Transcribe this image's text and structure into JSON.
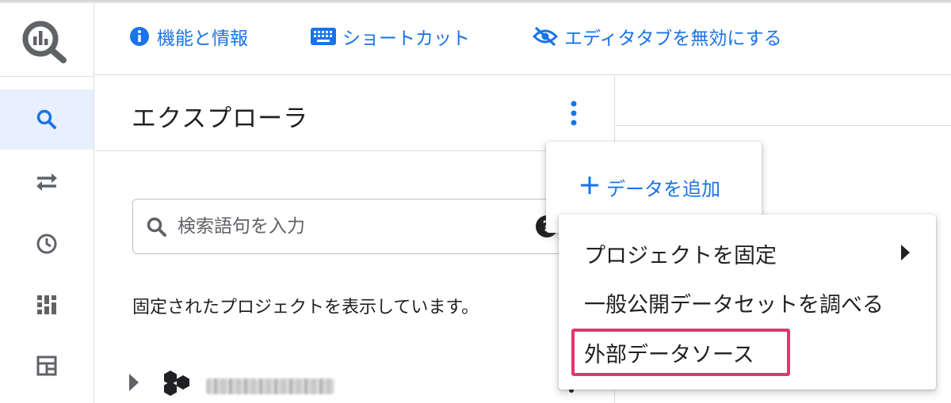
{
  "toolbar": {
    "features_label": "機能と情報",
    "shortcuts_label": "ショートカット",
    "editor_tabs_label": "エディタタブを無効にする"
  },
  "rail": {
    "items": [
      "search-icon",
      "transfer-icon",
      "history-icon",
      "dashboard-icon",
      "table-icon"
    ],
    "active": "search-icon"
  },
  "explorer": {
    "title": "エクスプローラ",
    "search": {
      "placeholder": "検索語句を入力",
      "value": ""
    },
    "pinned_message": "固定されたプロジェクトを表示しています。"
  },
  "add_data_menu": {
    "add_data_label": "データを追加"
  },
  "add_data_submenu": {
    "items": [
      "プロジェクトを固定",
      "一般公開データセットを調べる",
      "外部データソース"
    ],
    "highlighted": "外部データソース"
  },
  "colors": {
    "accent": "#1a73e8",
    "rail_active_bg": "#e8f0fe",
    "highlight_border": "#e8336f",
    "divider": "#dadce0"
  }
}
